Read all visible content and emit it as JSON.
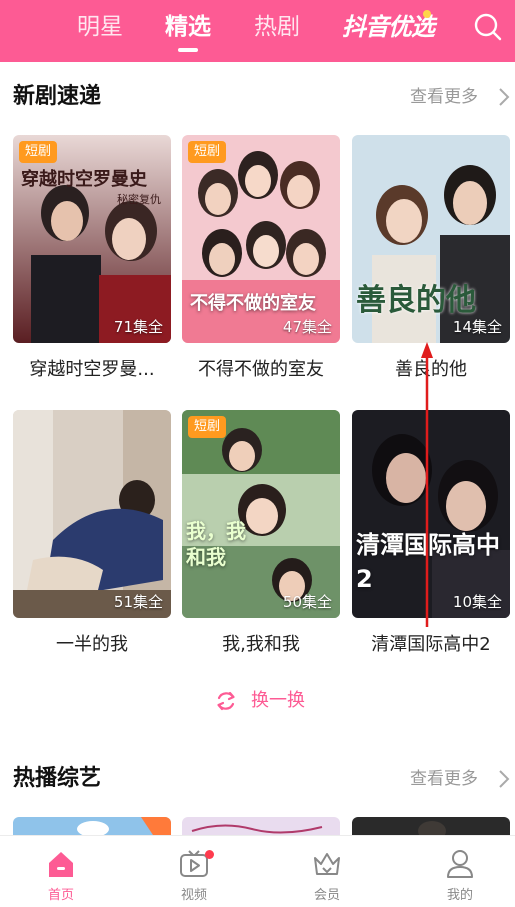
{
  "header": {
    "tabs": [
      {
        "label": "明星"
      },
      {
        "label": "精选"
      },
      {
        "label": "热剧"
      }
    ],
    "brand": "抖音优选",
    "colors": {
      "header_bg": "#fd5b94",
      "accent": "#fd5b94",
      "badge": "#ff9a1f"
    }
  },
  "new_dramas": {
    "title": "新剧速递",
    "more": "查看更多",
    "items": [
      {
        "name": "穿越时空罗曼...",
        "badge": "短剧",
        "episodes": "71集全",
        "poster_title": "穿越时空罗曼史",
        "poster_subtitle": "秘密复仇"
      },
      {
        "name": "不得不做的室友",
        "badge": "短剧",
        "episodes": "47集全",
        "poster_title": "不得不做的室友"
      },
      {
        "name": "善良的他",
        "episodes": "14集全",
        "poster_title": "善良的他"
      },
      {
        "name": "一半的我",
        "episodes": "51集全"
      },
      {
        "name": "我,我和我",
        "badge": "短剧",
        "episodes": "50集全",
        "poster_title": "我，我和我"
      },
      {
        "name": "清潭国际高中2",
        "episodes": "10集全",
        "poster_title": "清潭国际高中2"
      }
    ],
    "refresh": "换一换"
  },
  "variety": {
    "title": "热播综艺",
    "more": "查看更多"
  },
  "bottom_nav": [
    {
      "label": "首页",
      "icon": "home-icon",
      "active": true
    },
    {
      "label": "视频",
      "icon": "video-icon"
    },
    {
      "label": "会员",
      "icon": "crown-icon"
    },
    {
      "label": "我的",
      "icon": "user-icon"
    }
  ]
}
